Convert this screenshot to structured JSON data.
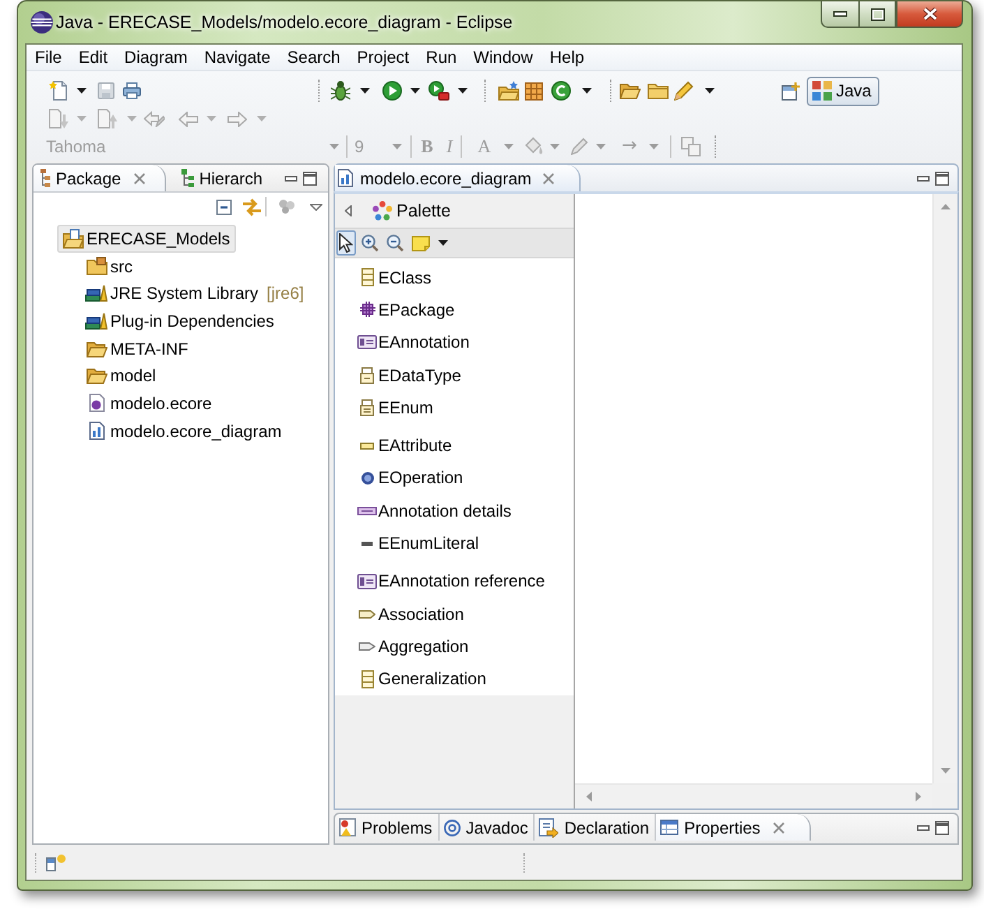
{
  "window": {
    "title": "Java - ERECASE_Models/modelo.ecore_diagram - Eclipse"
  },
  "menu_bar": [
    "File",
    "Edit",
    "Diagram",
    "Navigate",
    "Search",
    "Project",
    "Run",
    "Window",
    "Help"
  ],
  "font_toolbar": {
    "disabled": true,
    "font": "Tahoma",
    "size": "9",
    "bold": "B",
    "italic": "I",
    "text_color": "A",
    "line_end": "→"
  },
  "perspectives": [
    {
      "label": "Java",
      "selected": true
    }
  ],
  "package_explorer": {
    "tabs": [
      {
        "label": "Package",
        "kind": "package",
        "selected": true
      },
      {
        "label": "Hierarch",
        "kind": "hierarchy",
        "selected": false
      }
    ],
    "tree": [
      {
        "label": "ERECASE_Models",
        "kind": "project",
        "selected": true,
        "children": [
          {
            "label": "src",
            "kind": "source-folder",
            "selected": false
          },
          {
            "label": "JRE System Library",
            "decoration": "[jre6]",
            "kind": "library",
            "selected": false
          },
          {
            "label": "Plug-in Dependencies",
            "kind": "library",
            "selected": false
          },
          {
            "label": "META-INF",
            "kind": "folder",
            "selected": false
          },
          {
            "label": "model",
            "kind": "folder",
            "selected": false
          },
          {
            "label": "modelo.ecore",
            "kind": "model-file",
            "selected": false
          },
          {
            "label": "modelo.ecore_diagram",
            "kind": "diagram-file",
            "selected": false
          }
        ]
      }
    ]
  },
  "editor": {
    "tabs": [
      {
        "label": "modelo.ecore_diagram",
        "selected": true
      }
    ],
    "palette": {
      "title": "Palette",
      "tools_row": [
        {
          "kind": "select",
          "selected": true
        },
        {
          "kind": "zoom-in",
          "selected": false
        },
        {
          "kind": "zoom-out",
          "selected": false
        },
        {
          "kind": "note",
          "selected": false
        }
      ],
      "groups": [
        {
          "tools": [
            {
              "label": "EClass",
              "kind": "class",
              "selected": false
            },
            {
              "label": "EPackage",
              "kind": "package",
              "selected": false
            },
            {
              "label": "EAnnotation",
              "kind": "annotation",
              "selected": false
            },
            {
              "label": "EDataType",
              "kind": "datatype",
              "selected": false
            },
            {
              "label": "EEnum",
              "kind": "enum",
              "selected": false
            }
          ]
        },
        {
          "tools": [
            {
              "label": "EAttribute",
              "kind": "attribute",
              "selected": false
            },
            {
              "label": "EOperation",
              "kind": "operation",
              "selected": false
            },
            {
              "label": "Annotation details",
              "kind": "annotation-details",
              "selected": false
            },
            {
              "label": "EEnumLiteral",
              "kind": "enum-literal",
              "selected": false
            }
          ]
        },
        {
          "tools": [
            {
              "label": "EAnnotation reference",
              "kind": "annotation-reference",
              "selected": false
            },
            {
              "label": "Association",
              "kind": "association",
              "selected": false
            },
            {
              "label": "Aggregation",
              "kind": "aggregation",
              "selected": false
            },
            {
              "label": "Generalization",
              "kind": "generalization",
              "selected": false
            }
          ]
        }
      ]
    }
  },
  "bottom_panel": {
    "tabs": [
      {
        "label": "Problems",
        "kind": "problems",
        "selected": false
      },
      {
        "label": "Javadoc",
        "kind": "javadoc",
        "selected": false
      },
      {
        "label": "Declaration",
        "kind": "declaration",
        "selected": false
      },
      {
        "label": "Properties",
        "kind": "properties",
        "selected": true
      }
    ]
  }
}
